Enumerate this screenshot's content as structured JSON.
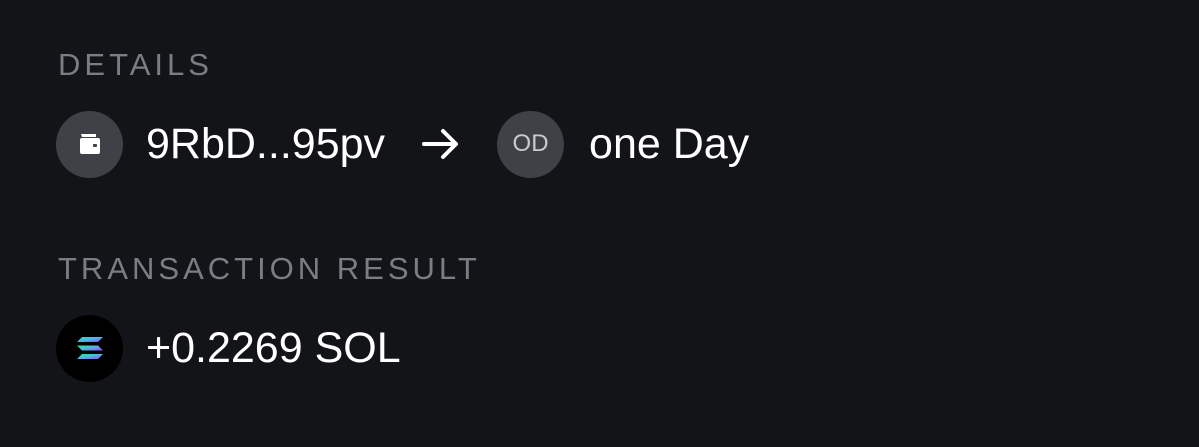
{
  "details": {
    "label": "DETAILS",
    "from_address": "9RbD...95pv",
    "to_initials": "OD",
    "to_name": "one Day"
  },
  "result": {
    "label": "TRANSACTION RESULT",
    "amount": "+0.2269 SOL",
    "token_icon": "solana-icon"
  },
  "colors": {
    "background": "#131418",
    "label": "#7b7d84",
    "avatar_bg": "#3f4147",
    "text": "#ffffff"
  }
}
